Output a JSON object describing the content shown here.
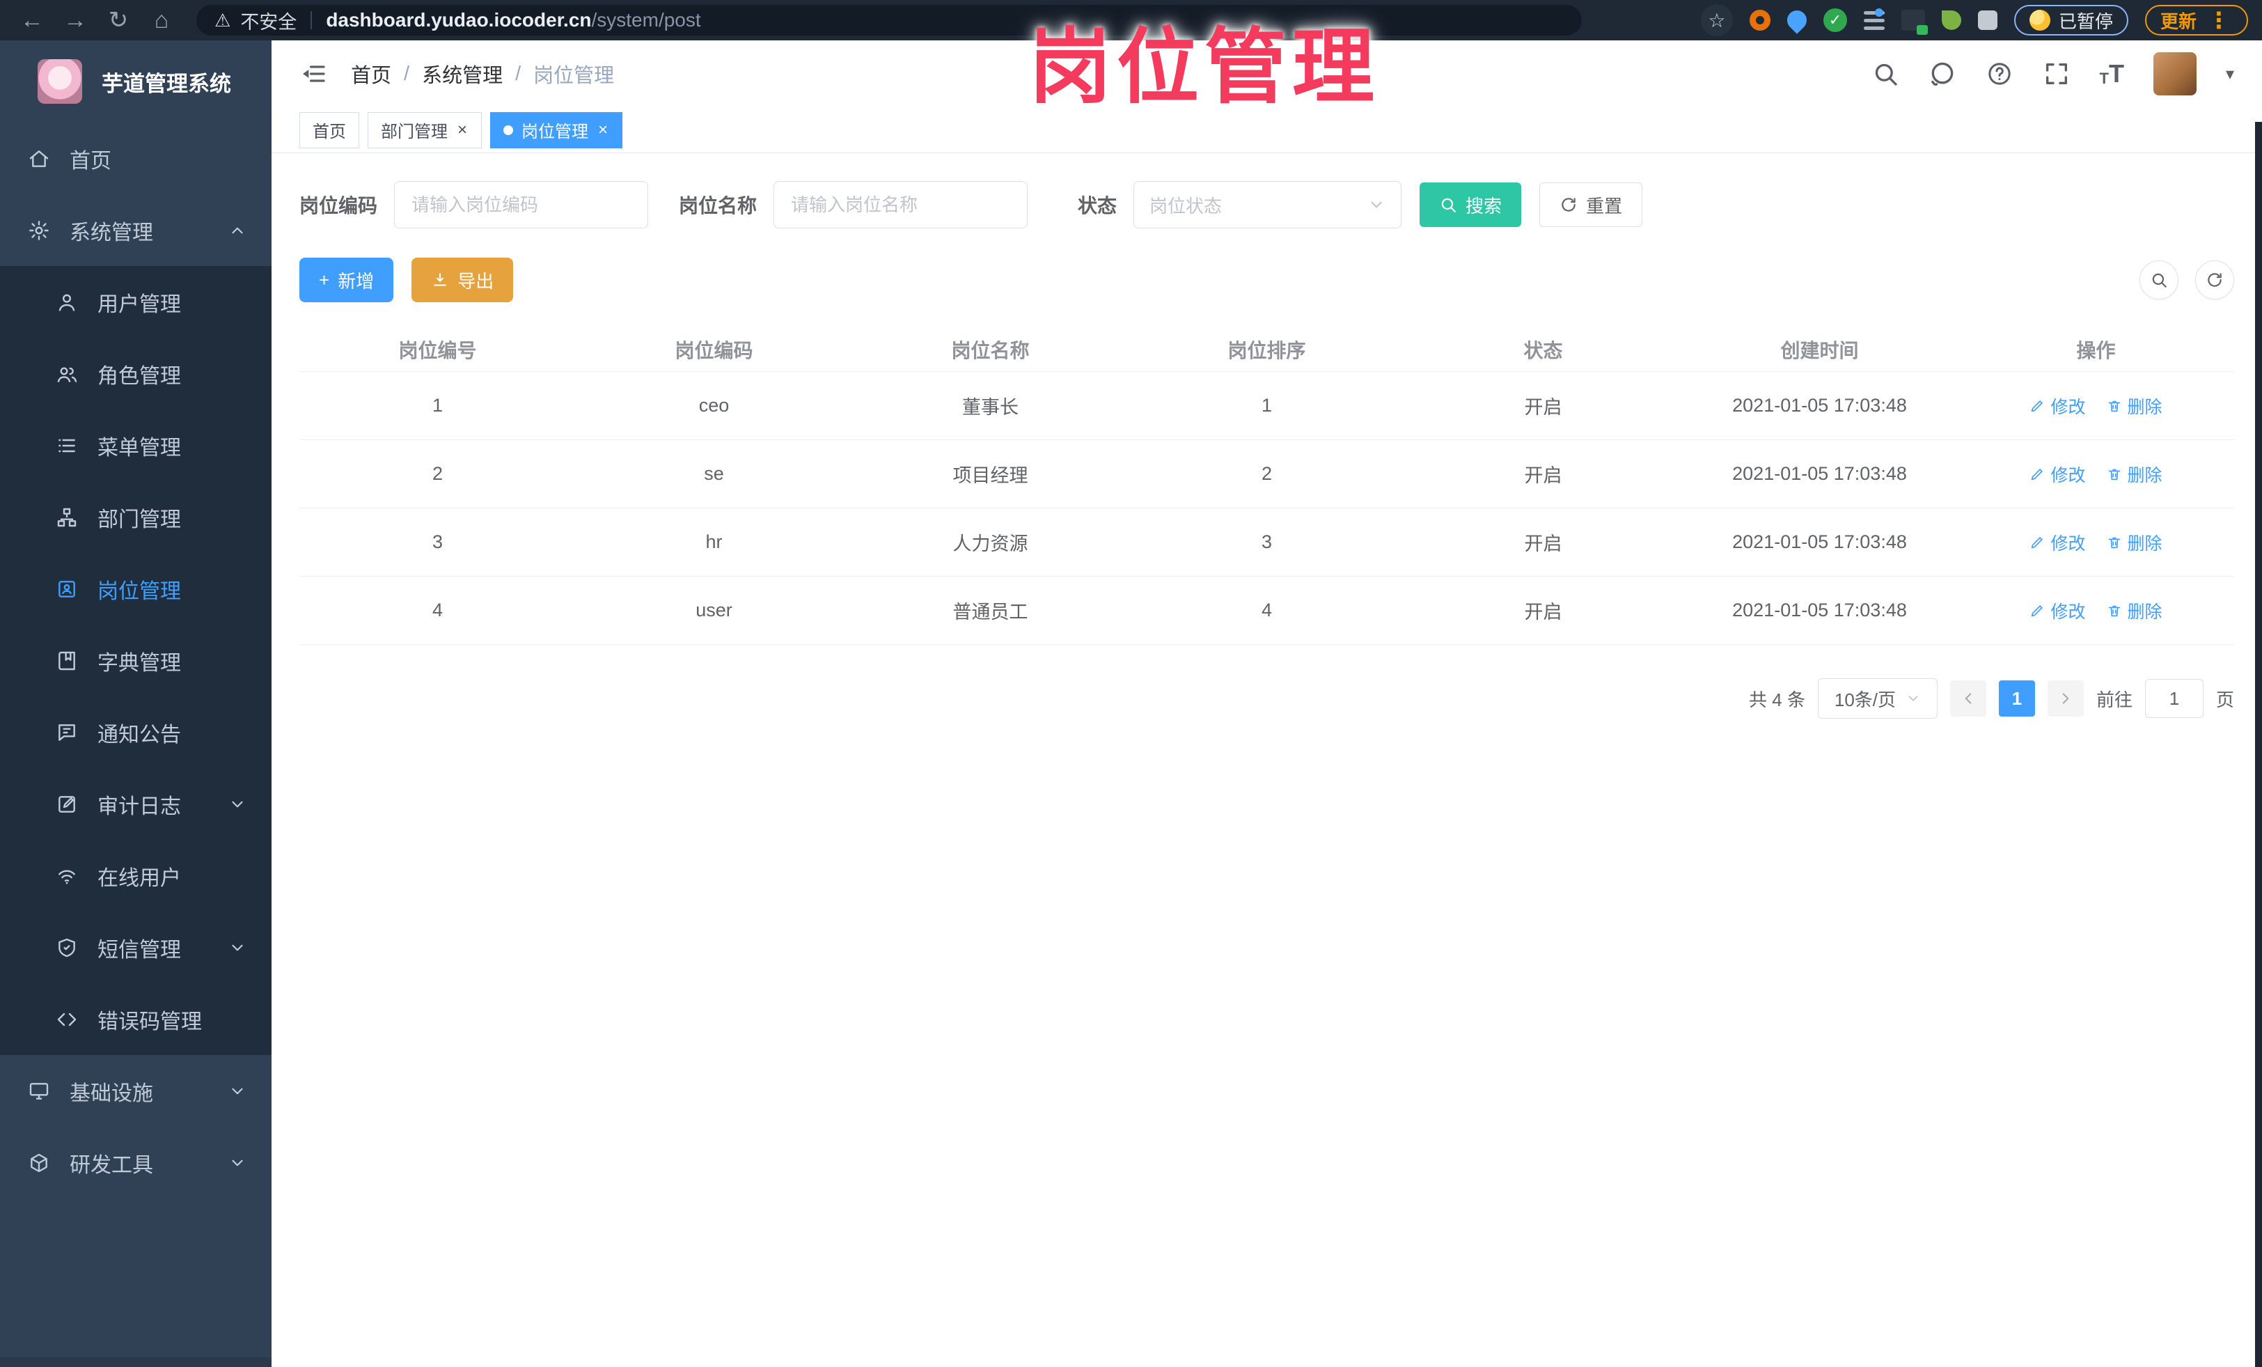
{
  "browser": {
    "security_label": "不安全",
    "url_host": "dashboard.yudao.iocoder.cn",
    "url_path": "/system/post",
    "paused_badge": "已暂停",
    "update_label": "更新"
  },
  "watermark": "岗位管理",
  "icons": {
    "back": "←",
    "forward": "→",
    "reload": "↻",
    "home": "⌂",
    "warning": "⚠",
    "star": "☆",
    "check": "✓",
    "dots": "⋮",
    "close": "×",
    "plus": "+",
    "caret": "▾",
    "font_size_small": "T",
    "font_size_large": "T"
  },
  "sidebar": {
    "app_title": "芋道管理系统",
    "items": [
      {
        "label": "首页"
      },
      {
        "label": "系统管理"
      },
      {
        "label": "用户管理"
      },
      {
        "label": "角色管理"
      },
      {
        "label": "菜单管理"
      },
      {
        "label": "部门管理"
      },
      {
        "label": "岗位管理"
      },
      {
        "label": "字典管理"
      },
      {
        "label": "通知公告"
      },
      {
        "label": "审计日志"
      },
      {
        "label": "在线用户"
      },
      {
        "label": "短信管理"
      },
      {
        "label": "错误码管理"
      },
      {
        "label": "基础设施"
      },
      {
        "label": "研发工具"
      }
    ]
  },
  "breadcrumb": {
    "sep": "/",
    "items": [
      {
        "label": "首页"
      },
      {
        "label": "系统管理"
      },
      {
        "label": "岗位管理"
      }
    ]
  },
  "tabs": [
    {
      "label": "首页"
    },
    {
      "label": "部门管理"
    },
    {
      "label": "岗位管理"
    }
  ],
  "filters": {
    "code_label": "岗位编码",
    "code_placeholder": "请输入岗位编码",
    "name_label": "岗位名称",
    "name_placeholder": "请输入岗位名称",
    "status_label": "状态",
    "status_placeholder": "岗位状态",
    "search_label": "搜索",
    "reset_label": "重置"
  },
  "toolbar": {
    "add_label": "新增",
    "export_label": "导出"
  },
  "table": {
    "headers": [
      "岗位编号",
      "岗位编码",
      "岗位名称",
      "岗位排序",
      "状态",
      "创建时间",
      "操作"
    ],
    "actions": {
      "edit": "修改",
      "delete": "删除"
    },
    "rows": [
      {
        "cells": [
          "1",
          "ceo",
          "董事长",
          "1",
          "开启",
          "2021-01-05 17:03:48"
        ]
      },
      {
        "cells": [
          "2",
          "se",
          "项目经理",
          "2",
          "开启",
          "2021-01-05 17:03:48"
        ]
      },
      {
        "cells": [
          "3",
          "hr",
          "人力资源",
          "3",
          "开启",
          "2021-01-05 17:03:48"
        ]
      },
      {
        "cells": [
          "4",
          "user",
          "普通员工",
          "4",
          "开启",
          "2021-01-05 17:03:48"
        ]
      }
    ]
  },
  "pagination": {
    "total": "共 4 条",
    "page_size": "10条/页",
    "current_page": "1",
    "goto_label": "前往",
    "goto_value": "1",
    "page_unit": "页"
  },
  "colors": {
    "accent": "#409EFF",
    "search_button": "#2EC7A6",
    "export_button": "#E6A23C",
    "watermark": "#F43B5E",
    "sidebar_bg": "#304156",
    "submenu_bg": "#1F2D3D"
  }
}
